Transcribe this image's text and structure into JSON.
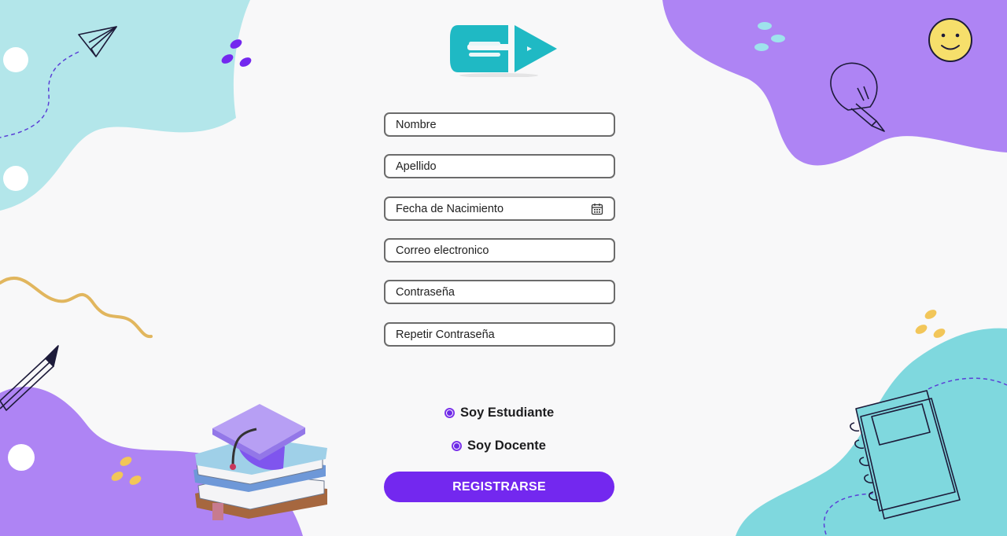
{
  "form": {
    "fields": [
      {
        "placeholder": "Nombre"
      },
      {
        "placeholder": "Apellido"
      },
      {
        "placeholder": "Fecha de Nacimiento",
        "icon": "calendar-icon"
      },
      {
        "placeholder": "Correo electronico"
      },
      {
        "placeholder": "Contraseña"
      },
      {
        "placeholder": "Repetir Contraseña"
      }
    ],
    "roles": [
      {
        "label": "Soy Estudiante"
      },
      {
        "label": "Soy Docente"
      }
    ],
    "submit_label": "REGISTRARSE"
  },
  "theme": {
    "accent": "#7328ef",
    "purple_blob": "#ae84f4",
    "teal_blob": "#7fd8de",
    "light_teal_blob": "#b3e6ea",
    "logo_teal": "#1fb9c4",
    "yellow": "#e8c064"
  }
}
